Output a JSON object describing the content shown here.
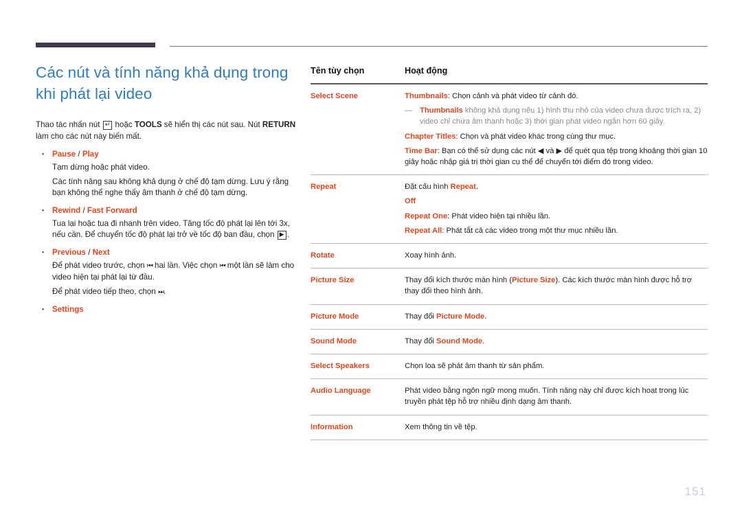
{
  "header": {
    "thick_rule_color": "#413a4e",
    "thin_rule_color": "#6f6f73"
  },
  "left": {
    "title": "Các nút và tính năng khả dụng trong khi phát lại video",
    "title_color": "#2f7cc0",
    "intro_pre": "Thao tác nhấn nút ",
    "intro_key_icon": "enter-key-icon",
    "intro_mid": " hoặc ",
    "intro_tools": "TOOLS",
    "intro_mid2": " sẽ hiển thị các nút sau. Nút ",
    "intro_return": "RETURN",
    "intro_post": " làm cho các nút này biến mất.",
    "bullets": [
      {
        "head_a": "Pause",
        "head_sep": " / ",
        "head_b": "Play",
        "lines": [
          "Tạm dừng hoặc phát video.",
          "Các tính năng sau không khả dụng ở chế độ tạm dừng. Lưu ý rằng bạn không thể nghe thấy âm thanh ở chế độ tạm dừng."
        ]
      },
      {
        "head_a": "Rewind",
        "head_sep": " / ",
        "head_b": "Fast Forward",
        "lines": [
          "Tua lại hoặc tua đi nhanh trên video. Tăng tốc độ phát lại lên tới 3x, nếu cần. Để chuyển tốc độ phát lại trở về tốc độ ban đầu, chọn "
        ],
        "trailing_icon": "play-icon",
        "trailing_text": "."
      },
      {
        "head_a": "Previous",
        "head_sep": " / ",
        "head_b": "Next",
        "lines_rich": [
          {
            "pre": "Để phát video trước, chọn ",
            "icon": "skip-backward-icon",
            "mid": " hai lần. Việc chọn ",
            "icon2": "skip-backward-icon",
            "post": " một lần sẽ làm cho video hiện tại phát lại từ đầu."
          },
          {
            "pre": "Để phát video tiếp theo, chọn ",
            "icon": "skip-forward-icon",
            "post": "."
          }
        ]
      },
      {
        "head_a": "Settings",
        "head_sep": "",
        "head_b": "",
        "lines": []
      }
    ]
  },
  "table": {
    "headers": [
      "Tên tùy chọn",
      "Hoạt động"
    ],
    "rows": [
      {
        "name": "Select Scene",
        "desc": [
          {
            "type": "line",
            "kw": "Thumbnails",
            "text": ": Chọn cảnh và phát video từ cảnh đó."
          },
          {
            "type": "note",
            "kw": "Thumbnails",
            "text": " không khả dụng nếu 1) hình thu nhỏ của video chưa được trích ra, 2) video chỉ chứa âm thanh hoặc 3) thời gian phát video ngắn hơn 60 giây."
          },
          {
            "type": "line",
            "kw": "Chapter Titles",
            "text": ": Chọn và phát video khác trong cùng thư mục."
          },
          {
            "type": "line",
            "kw": "Time Bar",
            "text": ": Bạn có thể sử dụng các nút ◀ và ▶ để quét qua tệp trong khoảng thời gian 10 giây hoặc nhập giá trị thời gian cụ thể để chuyển tới điểm đó trong video."
          }
        ]
      },
      {
        "name": "Repeat",
        "desc": [
          {
            "type": "line",
            "pre": "Đặt cấu hình ",
            "kw": "Repeat",
            "text": "."
          },
          {
            "type": "line",
            "kw": "Off",
            "text": ""
          },
          {
            "type": "line",
            "kw": "Repeat One",
            "text": ": Phát video hiện tại nhiều lần."
          },
          {
            "type": "line",
            "kw": "Repeat All",
            "text": ": Phát tắt cả các video trong một thư mục nhiều lần."
          }
        ]
      },
      {
        "name": "Rotate",
        "desc": [
          {
            "type": "line",
            "text": "Xoay hình ảnh."
          }
        ]
      },
      {
        "name": "Picture Size",
        "desc": [
          {
            "type": "line",
            "pre": "Thay đổi kích thước màn hình (",
            "kw": "Picture Size",
            "text": "). Các kích thước màn hình được hỗ trợ thay đổi theo hình ảnh."
          }
        ]
      },
      {
        "name": "Picture Mode",
        "desc": [
          {
            "type": "line",
            "pre": "Thay đổi ",
            "kw": "Picture Mode",
            "text": "."
          }
        ]
      },
      {
        "name": "Sound Mode",
        "desc": [
          {
            "type": "line",
            "pre": "Thay đổi ",
            "kw": "Sound Mode",
            "text": "."
          }
        ]
      },
      {
        "name": "Select Speakers",
        "desc": [
          {
            "type": "line",
            "text": "Chọn loa sẽ phát âm thanh từ sản phẩm."
          }
        ]
      },
      {
        "name": "Audio Language",
        "desc": [
          {
            "type": "line",
            "text": "Phát video bằng ngôn ngữ mong muốn. Tính năng này chỉ được kích hoạt trong lúc truyền phát tệp hỗ trợ nhiều định dạng âm thanh."
          }
        ]
      },
      {
        "name": "Information",
        "desc": [
          {
            "type": "line",
            "text": "Xem thông tin về tệp."
          }
        ]
      }
    ]
  },
  "footer": {
    "page_number": "151"
  }
}
